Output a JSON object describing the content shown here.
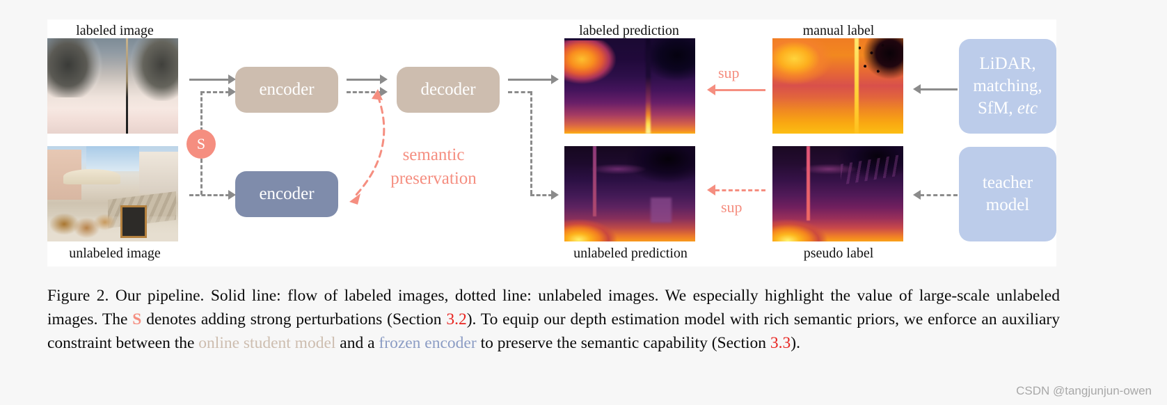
{
  "figure": {
    "labels": {
      "labeled_image": "labeled image",
      "unlabeled_image": "unlabeled image",
      "labeled_prediction": "labeled prediction",
      "unlabeled_prediction": "unlabeled prediction",
      "manual_label": "manual label",
      "pseudo_label": "pseudo label"
    },
    "nodes": {
      "encoder_top": "encoder",
      "decoder": "decoder",
      "encoder_bottom": "encoder",
      "perturbation_badge": "S",
      "lidar_line1": "LiDAR,",
      "lidar_line2": "matching,",
      "lidar_line3a": "SfM,",
      "lidar_line3b": "etc",
      "teacher_line1": "teacher",
      "teacher_line2": "model"
    },
    "annotations": {
      "semantic_line1": "semantic",
      "semantic_line2": "preservation",
      "sup_top": "sup",
      "sup_bottom": "sup"
    },
    "colors": {
      "encoder_tan": "#cdbdaf",
      "encoder_blue": "#7f8cab",
      "source_box_blue": "#bcccea",
      "accent_salmon": "#f58e80",
      "arrow_gray": "#8b8b8b",
      "caption_red": "#e8231f"
    }
  },
  "caption": {
    "t1": "Figure 2. Our pipeline. Solid line: flow of labeled images, dotted line: unlabeled images. We especially highlight the value of large-scale unlabeled images. The ",
    "s": "S",
    "t2": " denotes adding strong perturbations (Section ",
    "sec32": "3.2",
    "t3": "). To equip our depth estimation model with rich semantic priors, we enforce an auxiliary constraint between the ",
    "online_student": "online student model",
    "t4": " and a ",
    "frozen_encoder": "frozen encoder",
    "t5": " to preserve the semantic capability (Section ",
    "sec33": "3.3",
    "t6": ")."
  },
  "watermark": "CSDN @tangjunjun-owen"
}
